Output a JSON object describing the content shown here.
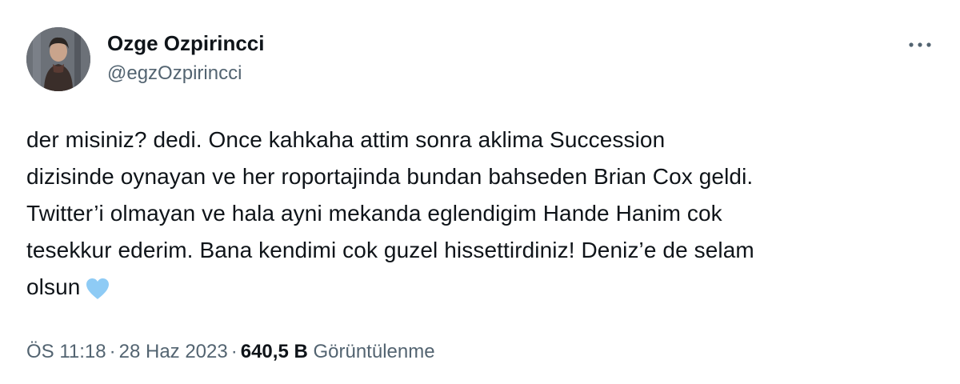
{
  "author": {
    "display_name": "Ozge Ozpirincci",
    "handle": "@egzOzpirincci"
  },
  "more_icon": "more-horizontal-icon",
  "tweet": {
    "lines": [
      "der misiniz? dedi. Once kahkaha attim sonra aklima Succession",
      "dizisinde oynayan ve her roportajinda bundan bahseden Brian Cox geldi.",
      "Twitter’i olmayan ve hala ayni mekanda eglendigim Hande Hanim cok",
      "tesekkur ederim. Bana kendimi cok guzel hissettirdiniz! Deniz’e de selam",
      "olsun"
    ],
    "emoji": "light-blue-heart-icon"
  },
  "meta": {
    "time": "ÖS 11:18",
    "separator": "·",
    "date": "28 Haz 2023",
    "views_count": "640,5 B",
    "views_label": "Görüntülenme"
  },
  "colors": {
    "text_primary": "#0f1419",
    "text_secondary": "#536471",
    "heart": "#8ecbf5",
    "background": "#ffffff"
  }
}
